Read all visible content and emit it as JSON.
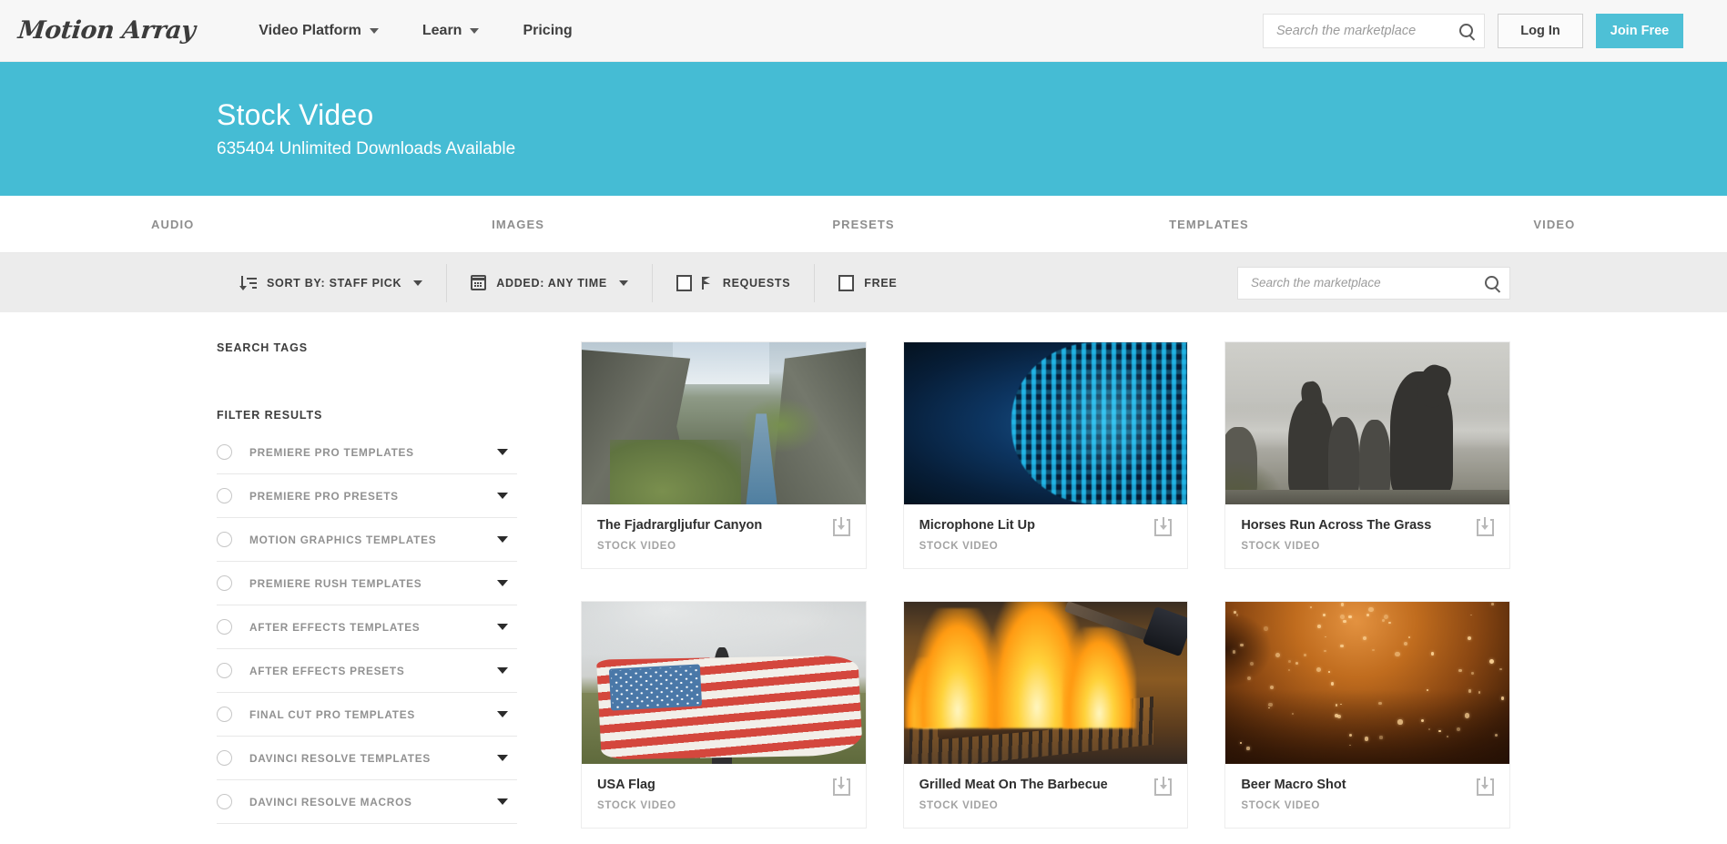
{
  "header": {
    "logo": "Motion Array",
    "nav": [
      {
        "label": "Video Platform",
        "has_caret": true
      },
      {
        "label": "Learn",
        "has_caret": true
      },
      {
        "label": "Pricing",
        "has_caret": false
      }
    ],
    "search_placeholder": "Search the marketplace",
    "search_value": "",
    "login_label": "Log In",
    "join_label": "Join Free",
    "accent_color": "#4ec0d6"
  },
  "hero": {
    "title": "Stock Video",
    "subtitle": "635404 Unlimited Downloads Available",
    "count": "635404",
    "background_color": "#45bcd4"
  },
  "tabs": [
    {
      "label": "AUDIO"
    },
    {
      "label": "IMAGES"
    },
    {
      "label": "PRESETS"
    },
    {
      "label": "TEMPLATES"
    },
    {
      "label": "VIDEO"
    }
  ],
  "toolbar": {
    "sort_label": "SORT BY: STAFF PICK",
    "added_label": "ADDED: ANY TIME",
    "requests_label": "REQUESTS",
    "requests_checked": false,
    "free_label": "FREE",
    "free_checked": false,
    "search_placeholder": "Search the marketplace",
    "search_value": ""
  },
  "sidebar": {
    "search_tags_heading": "SEARCH TAGS",
    "filter_results_heading": "FILTER RESULTS",
    "filters": [
      {
        "label": "PREMIERE PRO TEMPLATES"
      },
      {
        "label": "PREMIERE PRO PRESETS"
      },
      {
        "label": "MOTION GRAPHICS TEMPLATES"
      },
      {
        "label": "PREMIERE RUSH TEMPLATES"
      },
      {
        "label": "AFTER EFFECTS TEMPLATES"
      },
      {
        "label": "AFTER EFFECTS PRESETS"
      },
      {
        "label": "FINAL CUT PRO TEMPLATES"
      },
      {
        "label": "DAVINCI RESOLVE TEMPLATES"
      },
      {
        "label": "DAVINCI RESOLVE MACROS"
      }
    ]
  },
  "results": {
    "cards": [
      {
        "title": "The Fjadrargljufur Canyon",
        "meta": "STOCK VIDEO",
        "art": "canyon"
      },
      {
        "title": "Microphone Lit Up",
        "meta": "STOCK VIDEO",
        "art": "mic"
      },
      {
        "title": "Horses Run Across The Grass",
        "meta": "STOCK VIDEO",
        "art": "horses"
      },
      {
        "title": "USA Flag",
        "meta": "STOCK VIDEO",
        "art": "flag"
      },
      {
        "title": "Grilled Meat On The Barbecue",
        "meta": "STOCK VIDEO",
        "art": "grill"
      },
      {
        "title": "Beer Macro Shot",
        "meta": "STOCK VIDEO",
        "art": "beer"
      }
    ]
  }
}
